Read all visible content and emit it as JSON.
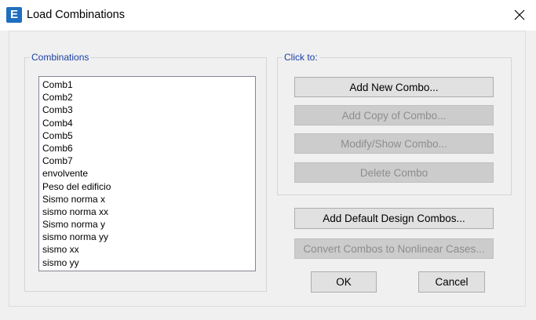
{
  "window": {
    "title": "Load Combinations",
    "app_icon_letter": "E"
  },
  "combinations": {
    "legend": "Combinations",
    "items": [
      "Comb1",
      "Comb2",
      "Comb3",
      "Comb4",
      "Comb5",
      "Comb6",
      "Comb7",
      "envolvente",
      "Peso del edificio",
      "Sismo norma x",
      "sismo norma xx",
      "Sismo norma y",
      "sismo norma yy",
      "sismo xx",
      "sismo yy"
    ]
  },
  "click_to": {
    "legend": "Click to:",
    "add_new": "Add New Combo...",
    "add_copy": "Add Copy of Combo...",
    "modify_show": "Modify/Show Combo...",
    "delete": "Delete Combo"
  },
  "buttons": {
    "add_default": "Add Default Design Combos...",
    "convert": "Convert Combos to Nonlinear Cases...",
    "ok": "OK",
    "cancel": "Cancel"
  },
  "colors": {
    "legend": "#1a3fa6",
    "app_icon": "#1e6fbf"
  }
}
